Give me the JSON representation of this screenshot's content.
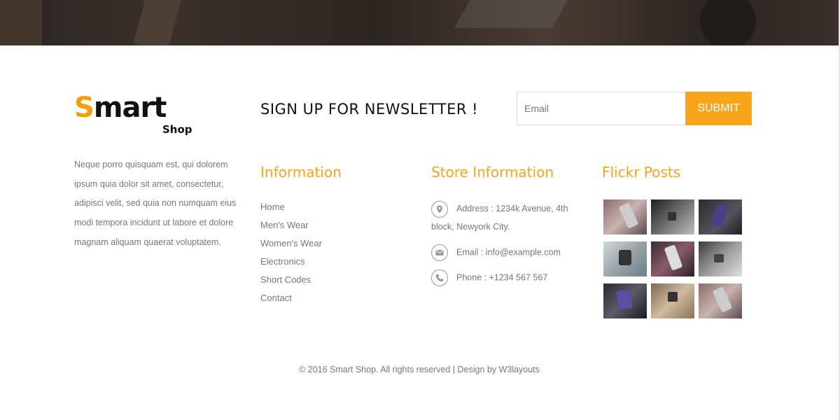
{
  "newsletter": {
    "title": "SIGN UP FOR NEWSLETTER !",
    "email_placeholder": "Email",
    "submit_label": "SUBMIT"
  },
  "brand": {
    "logo_s": "S",
    "logo_rest": "mart",
    "logo_sub": "Shop",
    "accent_color": "#f9a51a"
  },
  "about": {
    "text": "Neque porro quisquam est, qui dolorem ipsum quia dolor sit amet, consectetur, adipisci velit, sed quia non numquam eius modi tempora incidunt ut labore et dolore magnam aliquam quaerat voluptatem."
  },
  "information": {
    "title": "Information",
    "links": [
      "Home",
      "Men's Wear",
      "Women's Wear",
      "Electronics",
      "Short Codes",
      "Contact"
    ]
  },
  "store": {
    "title": "Store Information",
    "address": "Address : 1234k Avenue, 4th block, Newyork City.",
    "email": "Email : info@example.com",
    "phone": "Phone : +1234 567 567",
    "icons": [
      "map-marker-icon",
      "envelope-icon",
      "phone-icon"
    ]
  },
  "flickr": {
    "title": "Flickr Posts",
    "count": 9
  },
  "footer": {
    "copyright": "© 2016 Smart Shop. All rights reserved | Design by W3layouts"
  }
}
